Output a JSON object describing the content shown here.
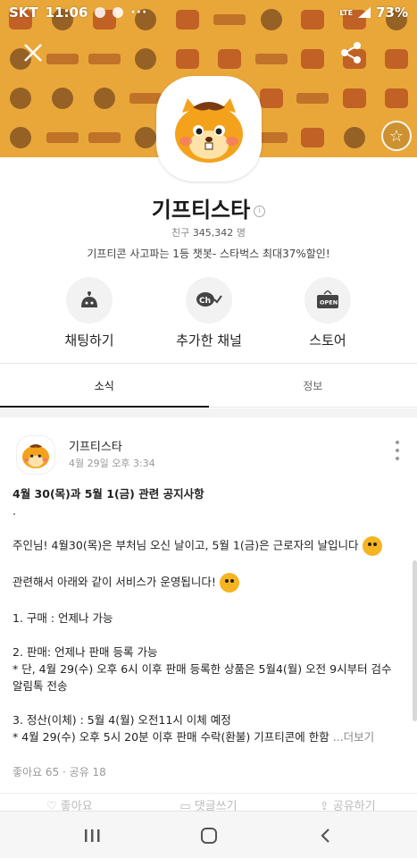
{
  "status_bar": {
    "carrier": "SKT",
    "time": "11:06",
    "signal_text": "LTE",
    "battery": "73%"
  },
  "banner": {
    "color": "#e9a73a"
  },
  "profile": {
    "name": "기프티스타",
    "friends_label": "친구",
    "friends_count": "345,342",
    "friends_suffix": "명",
    "description": "기프티콘 사고파는 1등 챗봇- 스타벅스 최대37%할인!"
  },
  "actions": [
    {
      "label": "채팅하기",
      "icon": "chat-bot-icon"
    },
    {
      "label": "추가한 채널",
      "icon": "channel-added-icon"
    },
    {
      "label": "스토어",
      "icon": "store-open-icon"
    }
  ],
  "tabs": [
    {
      "label": "소식",
      "active": true
    },
    {
      "label": "정보",
      "active": false
    }
  ],
  "post": {
    "author": "기프티스타",
    "date": "4월 29일 오후 3:34",
    "title": "4월 30(목)과 5월 1(금) 관련 공지사항",
    "dot": ".",
    "lines": {
      "l1": "주인님! 4월30(목)은 부처님 오신 날이고, 5월 1(금)은 근로자의 날입니다",
      "l2": "관련해서 아래와 같이 서비스가 운영됩니다!",
      "l3": "1. 구매 : 언제나 가능",
      "l4": "2. 판매: 언제나 판매 등록 가능",
      "l5": "* 단, 4월 29(수) 오후 6시 이후 판매 등록한 상품은 5월4(월) 오전 9시부터 검수",
      "l6": "알림톡 전송",
      "l7": "3. 정산(이체) : 5월 4(월) 오전11시 이체 예정",
      "l8": "* 4월 29(수) 오후 5시 20분 이후 판매 수락(환불) 기프티콘에 한함",
      "more": " ...더보기"
    },
    "likes": "좋아요 65 · 공유 18",
    "bottom_actions": {
      "like": "좋아요",
      "comment": "댓글쓰기",
      "share": "공유하기"
    }
  }
}
